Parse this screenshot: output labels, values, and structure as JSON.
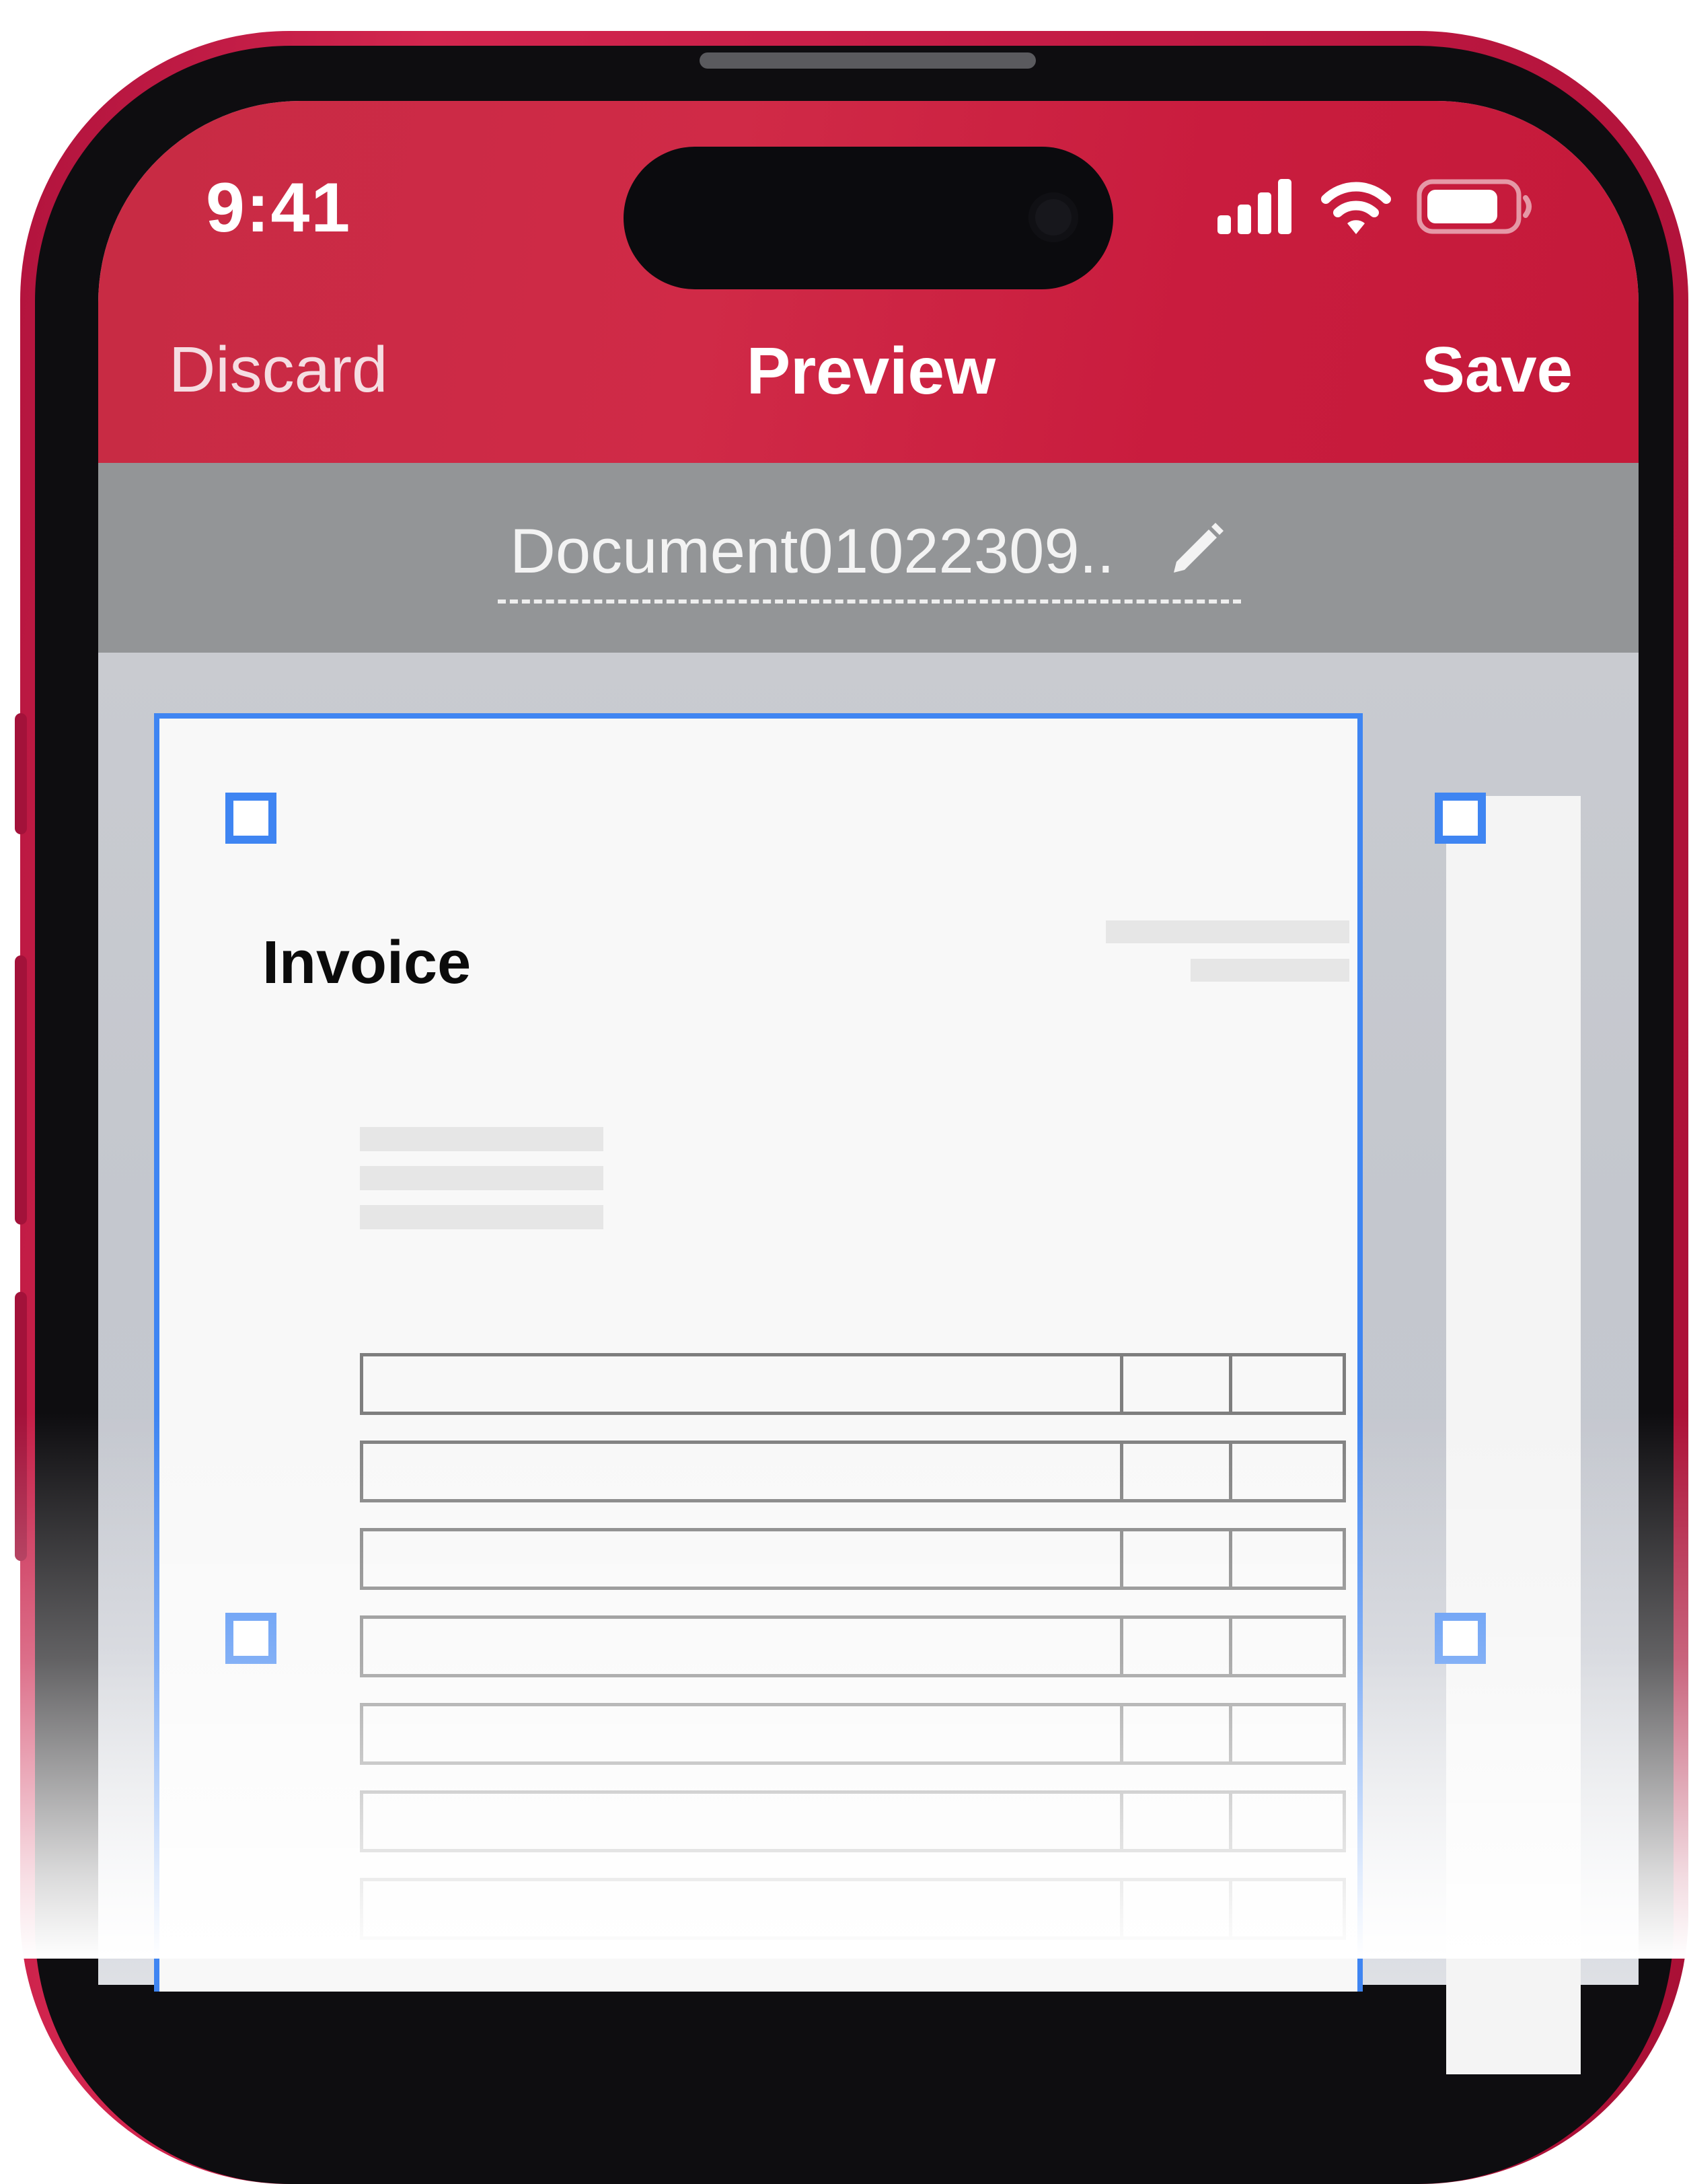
{
  "status_bar": {
    "time": "9:41",
    "signal_icon": "cellular-signal-icon",
    "wifi_icon": "wifi-icon",
    "battery_icon": "battery-icon"
  },
  "nav": {
    "discard_label": "Discard",
    "title": "Preview",
    "save_label": "Save"
  },
  "document": {
    "name": "Document01022309..",
    "edit_icon": "pencil-icon"
  },
  "page": {
    "title": "Invoice",
    "table_rows": 7,
    "table_columns": 3
  },
  "colors": {
    "header_red": "#c91c3e",
    "crop_blue": "#3f85f2",
    "docname_bar": "#939597"
  }
}
